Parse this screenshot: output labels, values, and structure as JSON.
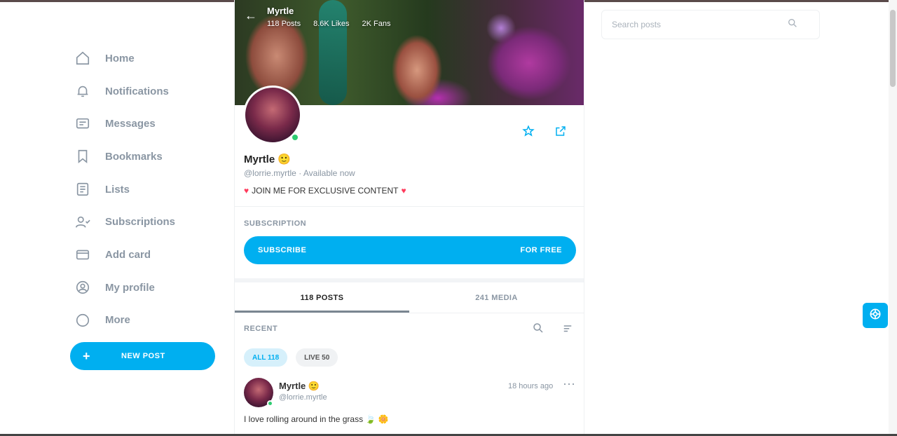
{
  "sidebar": {
    "items": [
      {
        "label": "Home",
        "icon": "home-icon"
      },
      {
        "label": "Notifications",
        "icon": "bell-icon"
      },
      {
        "label": "Messages",
        "icon": "chat-icon"
      },
      {
        "label": "Bookmarks",
        "icon": "bookmark-icon"
      },
      {
        "label": "Lists",
        "icon": "list-icon"
      },
      {
        "label": "Subscriptions",
        "icon": "subscriptions-icon"
      },
      {
        "label": "Add card",
        "icon": "card-icon"
      },
      {
        "label": "My profile",
        "icon": "user-icon"
      },
      {
        "label": "More",
        "icon": "more-icon"
      }
    ],
    "new_post": {
      "plus": "+",
      "label": "NEW POST"
    }
  },
  "cover": {
    "back": "←",
    "name": "Myrtle",
    "stats": [
      "118 Posts",
      "8.6K Likes",
      "2K Fans"
    ]
  },
  "profile": {
    "display_name": "Myrtle 🙂",
    "handle": "@lorrie.myrtle",
    "status": "Available now",
    "bio": "JOIN ME FOR EXCLUSIVE CONTENT"
  },
  "subscription": {
    "title": "SUBSCRIPTION",
    "button_left": "SUBSCRIBE",
    "button_right": "FOR FREE"
  },
  "tabs": [
    {
      "label": "118 POSTS",
      "active": true
    },
    {
      "label": "241 MEDIA",
      "active": false
    }
  ],
  "recent": {
    "title": "RECENT",
    "chips": [
      {
        "label": "ALL 118",
        "active": true
      },
      {
        "label": "LIVE 50",
        "active": false
      }
    ]
  },
  "post": {
    "name": "Myrtle 🙂",
    "handle": "@lorrie.myrtle",
    "time": "18 hours ago",
    "more": "···",
    "text": "I love rolling around in the grass 🍃 🌼"
  },
  "search": {
    "placeholder": "Search posts"
  },
  "colors": {
    "accent": "#00aff0",
    "muted": "#8a96a3"
  }
}
